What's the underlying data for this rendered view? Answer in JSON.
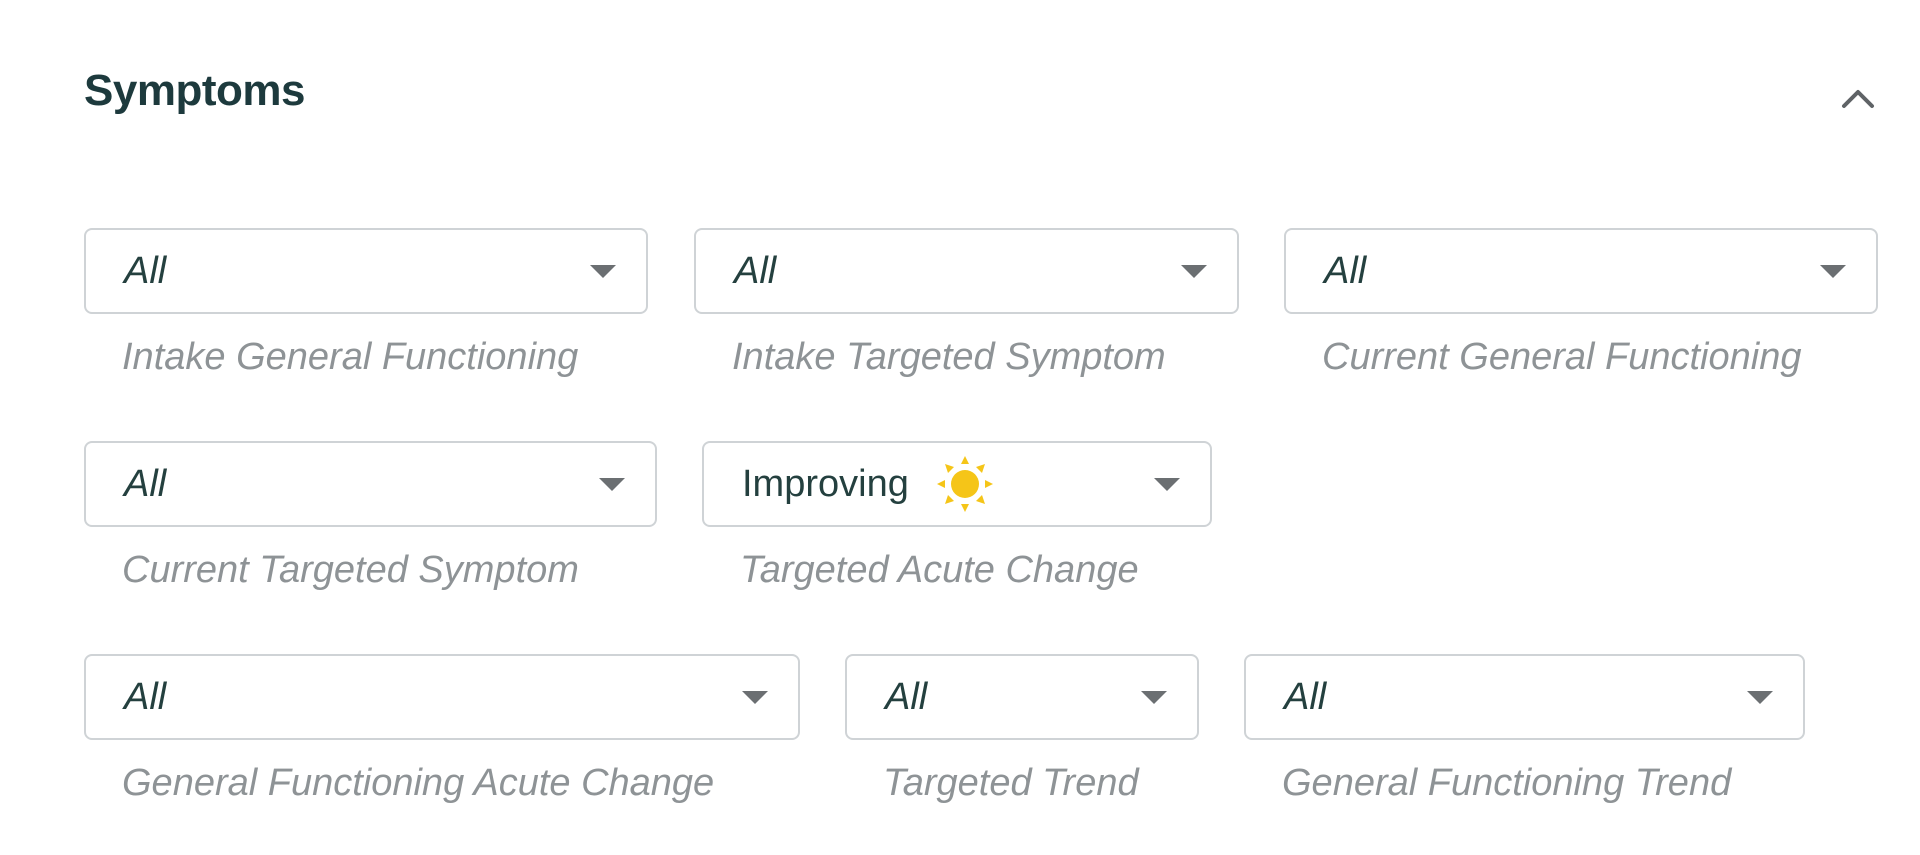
{
  "section": {
    "title": "Symptoms",
    "collapse_icon": "chevron-up-icon"
  },
  "filters": {
    "intake_general_functioning": {
      "value": "All",
      "label": "Intake General Functioning"
    },
    "intake_targeted_symptom": {
      "value": "All",
      "label": "Intake Targeted Symptom"
    },
    "current_general_functioning": {
      "value": "All",
      "label": "Current General Functioning"
    },
    "current_targeted_symptom": {
      "value": "All",
      "label": "Current Targeted Symptom"
    },
    "targeted_acute_change": {
      "value": "Improving",
      "label": "Targeted Acute Change",
      "icon": "sun-icon"
    },
    "general_functioning_acute_change": {
      "value": "All",
      "label": "General Functioning Acute Change"
    },
    "targeted_trend": {
      "value": "All",
      "label": "Targeted Trend"
    },
    "general_functioning_trend": {
      "value": "All",
      "label": "General Functioning Trend"
    }
  },
  "colors": {
    "title": "#1d3a3d",
    "label": "#8e9396",
    "border": "#cfd3d6",
    "sun": "#f5c518"
  }
}
